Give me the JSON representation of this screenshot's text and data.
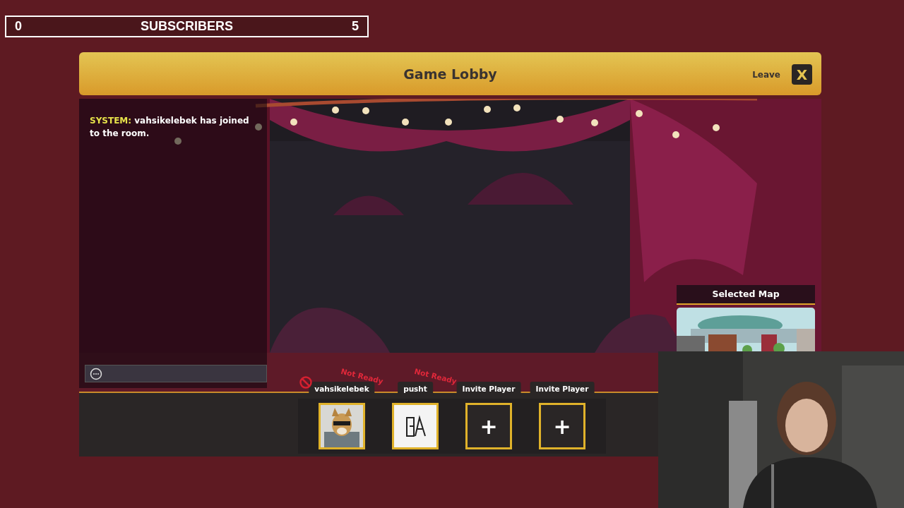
{
  "subscriber_goal": {
    "current": "0",
    "label": "SUBSCRIBERS",
    "target": "5"
  },
  "lobby": {
    "title": "Game Lobby",
    "leave_label": "Leave",
    "close_glyph": "X"
  },
  "chat": {
    "messages": [
      {
        "sender": "SYSTEM:",
        "text": "vahsikelebek has joined to the room."
      }
    ]
  },
  "selected_map": {
    "title": "Selected Map"
  },
  "players": [
    {
      "kind": "player",
      "name": "vahsikelebek",
      "status": "Not Ready",
      "blocked": true
    },
    {
      "kind": "player",
      "name": "pusht",
      "status": "Not Ready",
      "blocked": false
    },
    {
      "kind": "invite",
      "name": "Invite Player",
      "glyph": "+"
    },
    {
      "kind": "invite",
      "name": "Invite Player",
      "glyph": "+"
    }
  ]
}
